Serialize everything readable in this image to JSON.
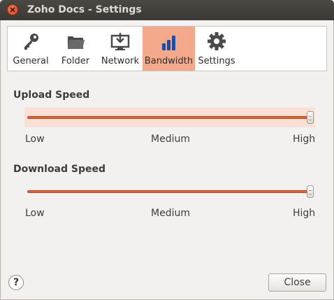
{
  "window": {
    "title": "Zoho Docs - Settings"
  },
  "tabs": [
    {
      "label": "General",
      "icon": "key-icon"
    },
    {
      "label": "Folder",
      "icon": "folder-icon"
    },
    {
      "label": "Network",
      "icon": "network-monitor-icon"
    },
    {
      "label": "Bandwidth",
      "icon": "bandwidth-bars-icon",
      "active": true
    },
    {
      "label": "Settings",
      "icon": "gear-icon"
    }
  ],
  "upload": {
    "label": "Upload Speed",
    "value": 1.0,
    "scale": {
      "low": "Low",
      "medium": "Medium",
      "high": "High"
    }
  },
  "download": {
    "label": "Download Speed",
    "value": 1.0,
    "scale": {
      "low": "Low",
      "medium": "Medium",
      "high": "High"
    }
  },
  "footer": {
    "help_label": "?",
    "close_label": "Close"
  },
  "colors": {
    "accent": "#e5602d",
    "active_tab": "#f4a98a",
    "titlebar": "#3f3e3a"
  }
}
